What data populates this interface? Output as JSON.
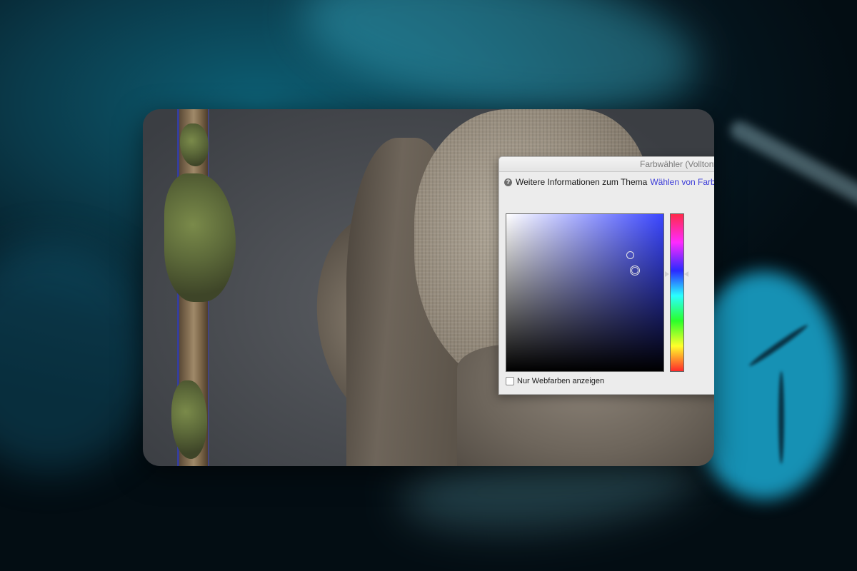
{
  "dialog": {
    "title": "Farbwähler (Volltonf",
    "info_text": "Weitere Informationen zum Thema",
    "info_link": "Wählen von Farbe",
    "help_icon": "question-mark-icon",
    "web_colors_label": "Nur Webfarben anzeigen",
    "web_colors_checked": false
  },
  "colors": {
    "field_hue": "#3a46ff",
    "link": "#3b3bd8"
  }
}
